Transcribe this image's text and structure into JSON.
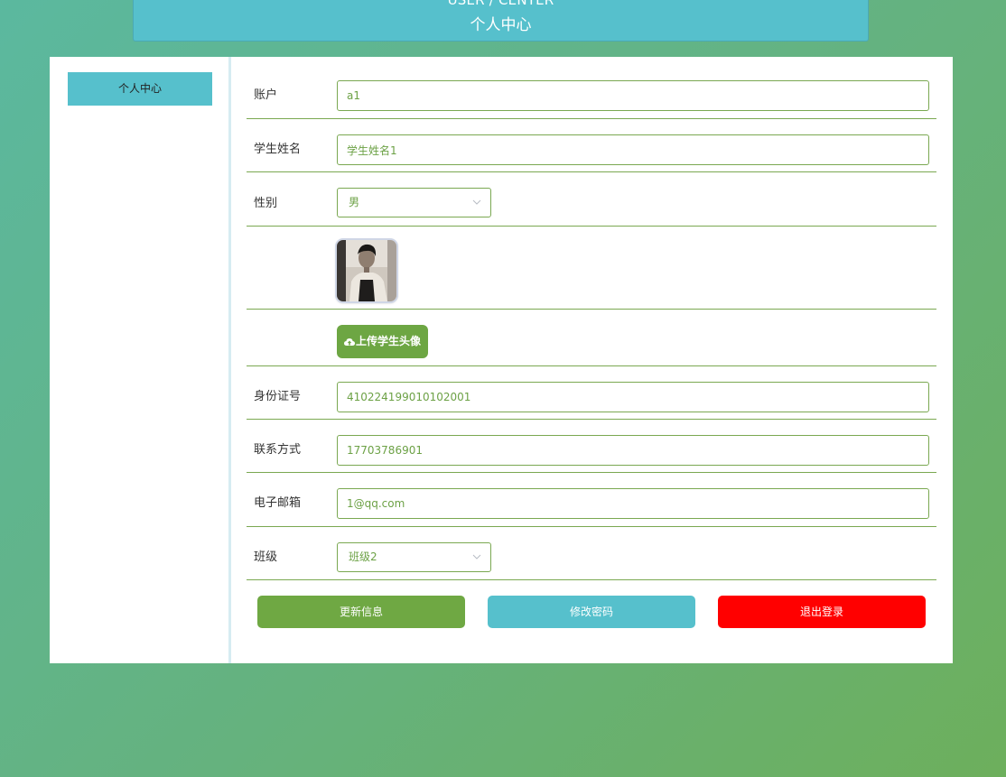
{
  "header": {
    "title_en": "USER / CENTER",
    "title_zh": "个人中心"
  },
  "sidebar": {
    "items": [
      {
        "label": "个人中心"
      }
    ]
  },
  "form": {
    "account": {
      "label": "账户",
      "value": "a1"
    },
    "name": {
      "label": "学生姓名",
      "value": "学生姓名1"
    },
    "gender": {
      "label": "性别",
      "value": "男"
    },
    "avatar": {
      "alt": "student avatar photo"
    },
    "upload": {
      "label": "上传学生头像"
    },
    "id_number": {
      "label": "身份证号",
      "value": "410224199010102001"
    },
    "phone": {
      "label": "联系方式",
      "value": "17703786901"
    },
    "email": {
      "label": "电子邮箱",
      "value": "1@qq.com"
    },
    "class": {
      "label": "班级",
      "value": "班级2"
    }
  },
  "actions": {
    "update_label": "更新信息",
    "password_label": "修改密码",
    "logout_label": "退出登录"
  },
  "colors": {
    "accent_teal": "#56c0cc",
    "accent_green": "#6fa843",
    "danger_red": "#ff0000"
  }
}
